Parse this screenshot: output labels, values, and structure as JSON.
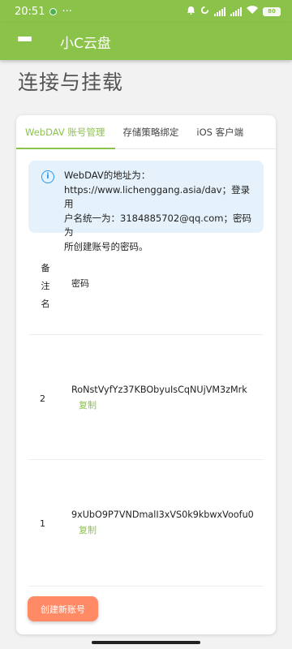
{
  "status_bar": {
    "time": "20:51",
    "dots": "···",
    "battery": "80"
  },
  "app_bar": {
    "menu_icon": "hamburger-menu-icon",
    "title": "小C云盘"
  },
  "page": {
    "title": "连接与挂载"
  },
  "tabs": [
    {
      "label": "WebDAV 账号管理",
      "active": true
    },
    {
      "label": "存储策略绑定",
      "active": false
    },
    {
      "label": "iOS 客户端",
      "active": false
    }
  ],
  "info": {
    "icon": "info-icon",
    "line1": "WebDAV的地址为：",
    "line2": "https://www.lichenggang.asia/dav；登录用",
    "line3": "户名统一为：3184885702@qq.com；密码为",
    "line4": "所创建账号的密码。"
  },
  "table": {
    "headers": {
      "remark_1": "备",
      "remark_2": "注",
      "remark_3": "名",
      "password": "密码"
    },
    "rows": [
      {
        "remark": "2",
        "password": "RoNstVyfYz37KBObyuIsCqNUjVM3zMrk",
        "copy": "复制"
      },
      {
        "remark": "1",
        "password": "9xUbO9P7VNDmalI3xVS0k9kbwxVoofu0",
        "copy": "复制"
      }
    ]
  },
  "actions": {
    "create_label": "创建新账号"
  },
  "colors": {
    "primary": "#8bc34a",
    "accent": "#ff8a65",
    "info_bg": "#e6f2fb",
    "info_icon": "#2196f3"
  }
}
